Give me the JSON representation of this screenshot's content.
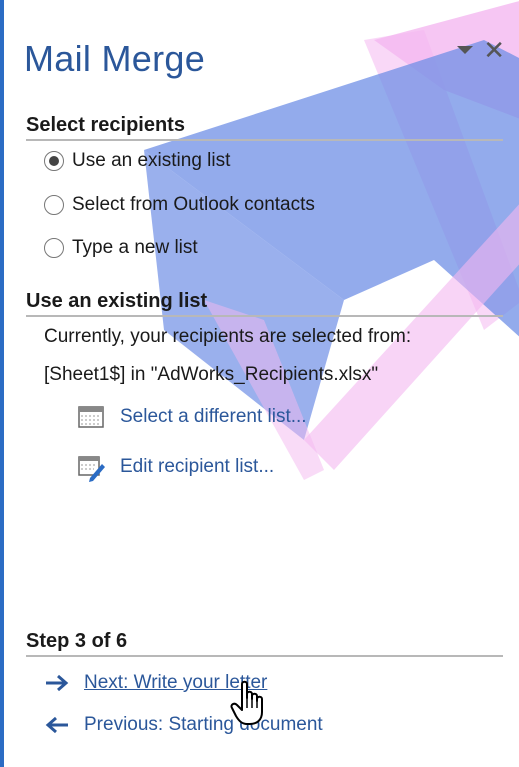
{
  "pane": {
    "title": "Mail Merge"
  },
  "select_recipients": {
    "heading": "Select recipients",
    "options": [
      {
        "label": "Use an existing list",
        "selected": true
      },
      {
        "label": "Select from Outlook contacts",
        "selected": false
      },
      {
        "label": "Type a new list",
        "selected": false
      }
    ]
  },
  "existing_list": {
    "heading": "Use an existing list",
    "description_line1": "Currently, your recipients are selected from:",
    "description_line2": "[Sheet1$] in \"AdWorks_Recipients.xlsx\"",
    "select_different_label": "Select a different list...",
    "edit_list_label": "Edit recipient list..."
  },
  "step": {
    "heading": "Step 3 of 6",
    "next_label": "Next: Write your letter",
    "previous_label": "Previous: Starting document"
  },
  "colors": {
    "accent": "#2b579a",
    "border": "#2b6cc4",
    "watermark_blue": "#6f8fe6",
    "watermark_pink": "#f4b8f0"
  }
}
